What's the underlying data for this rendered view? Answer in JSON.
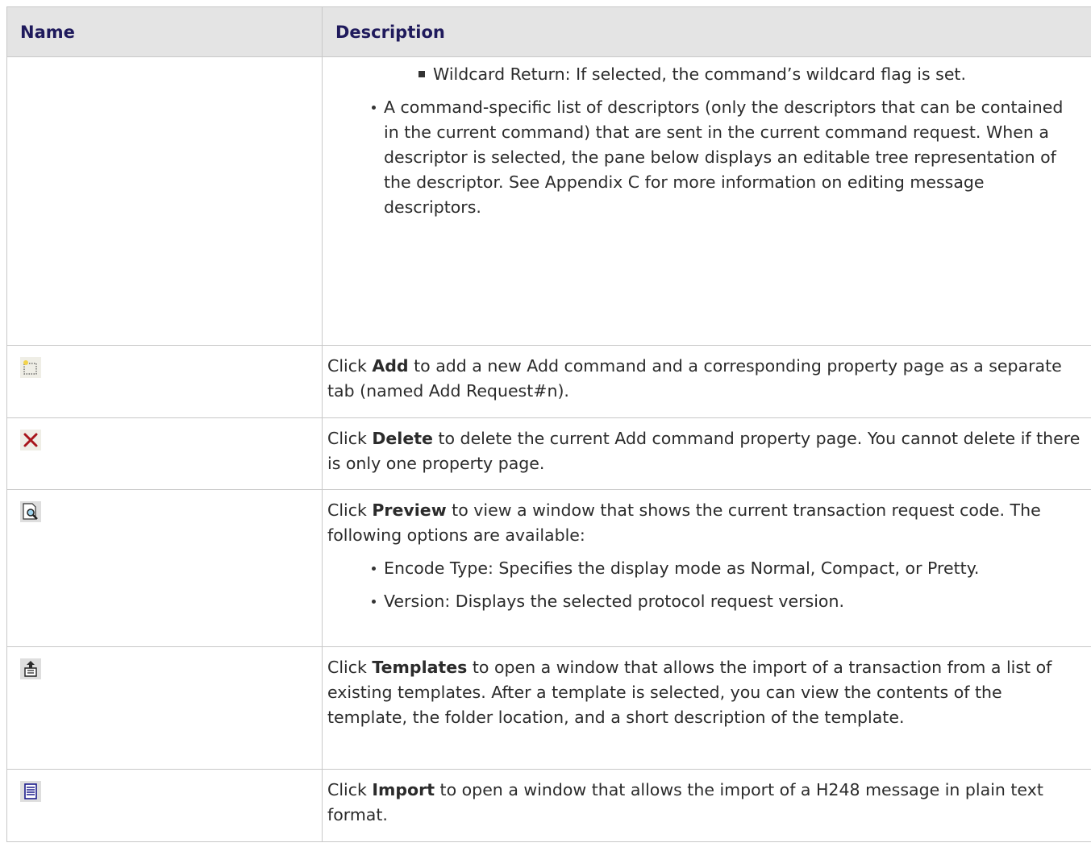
{
  "table": {
    "headers": {
      "name": "Name",
      "description": "Description"
    },
    "row1": {
      "sub_bullet": "Wildcard Return: If selected, the command’s wildcard flag is set.",
      "bullet": "A command-specific list of descriptors (only the descriptors that can be contained in the current command) that are sent in the current command request. When a descriptor is selected, the pane below displays an editable tree representation of the descriptor. See Appendix C for more information on editing message descriptors."
    },
    "row_add": {
      "icon": "new-item-icon",
      "pre": "Click ",
      "bold": "Add",
      "post": " to add a new Add command and a corresponding property page as a separate tab (named Add Request#n)."
    },
    "row_delete": {
      "icon": "delete-x-icon",
      "pre": "Click ",
      "bold": "Delete",
      "post": " to delete the current Add command property page. You cannot delete if there is only one property page."
    },
    "row_preview": {
      "icon": "preview-magnifier-icon",
      "pre": "Click ",
      "bold": "Preview",
      "post": " to view a window that shows the current transaction request code. The following options are available:",
      "bullets": [
        "Encode Type: Specifies the display mode as Normal, Compact, or Pretty.",
        "Version: Displays the selected protocol request version."
      ]
    },
    "row_templates": {
      "icon": "templates-upload-icon",
      "pre": "Click ",
      "bold": "Templates",
      "post": " to open a window that allows the import of a transaction from a list of existing templates. After a template is selected, you can view the contents of the template, the folder location, and a short description of the template."
    },
    "row_import": {
      "icon": "import-list-icon",
      "pre": "Click ",
      "bold": "Import",
      "post": " to open a window that allows the import of a H248 message in plain text format."
    }
  }
}
